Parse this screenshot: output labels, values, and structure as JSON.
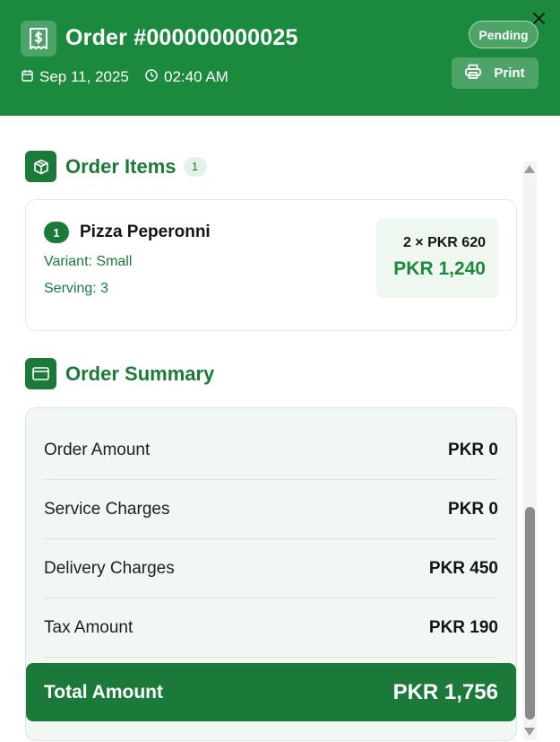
{
  "header": {
    "title": "Order #000000000025",
    "date": "Sep 11, 2025",
    "time": "02:40 AM",
    "status": "Pending",
    "print_label": "Print"
  },
  "items_section": {
    "title": "Order Items",
    "count": "1",
    "items": [
      {
        "number": "1",
        "name": "Pizza Peperonni",
        "variant": "Variant: Small",
        "serving": "Serving: 3",
        "qty_price": "2 × PKR 620",
        "total": "PKR 1,240"
      }
    ]
  },
  "summary_section": {
    "title": "Order Summary",
    "rows": [
      {
        "label": "Order Amount",
        "value": "PKR 0"
      },
      {
        "label": "Service Charges",
        "value": "PKR 0"
      },
      {
        "label": "Delivery Charges",
        "value": "PKR 450"
      },
      {
        "label": "Tax Amount",
        "value": "PKR 190"
      }
    ],
    "total_label": "Total Amount",
    "total_value": "PKR 1,756"
  },
  "colors": {
    "brand_green": "#1b8a3e",
    "dark_green": "#1b7a3a",
    "summary_bg": "#f1f7f2"
  },
  "icons": [
    "receipt-icon",
    "calendar-icon",
    "clock-icon",
    "close-icon",
    "printer-icon",
    "package-icon",
    "card-icon"
  ]
}
